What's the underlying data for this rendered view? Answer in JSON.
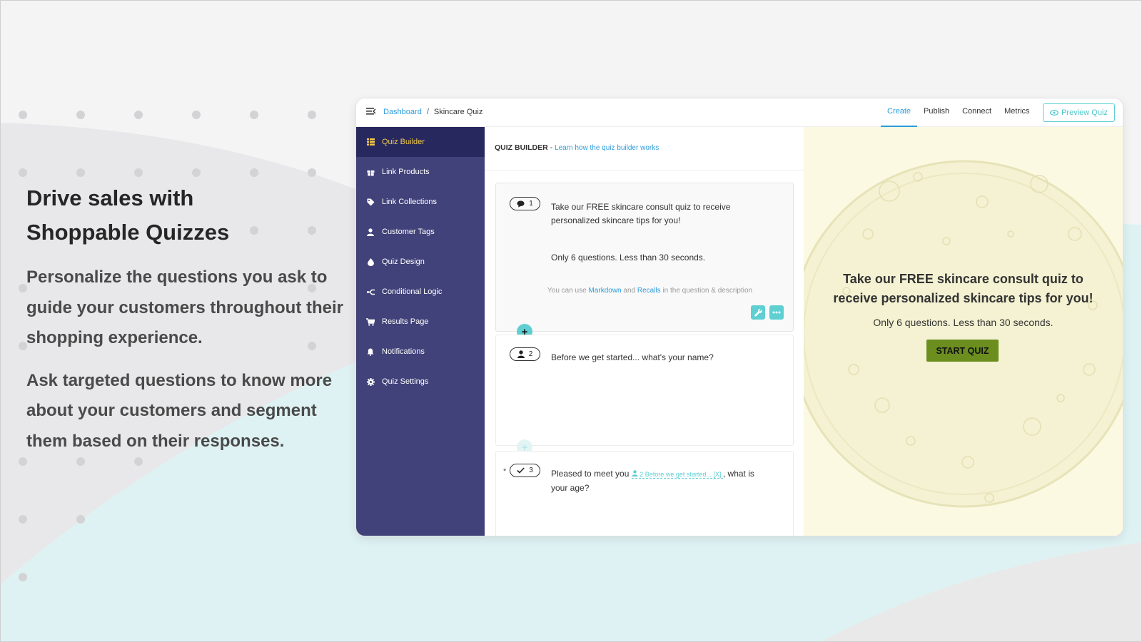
{
  "marketing": {
    "headline_line1": "Drive sales with",
    "headline_line2": "Shoppable Quizzes",
    "paragraph1": "Personalize the questions you ask to guide your customers throughout their shopping experience.",
    "paragraph2": "Ask targeted questions to know more about your customers and segment them based on their responses."
  },
  "topbar": {
    "menu_icon": "hamburger-menu-icon",
    "breadcrumb": {
      "root": "Dashboard",
      "separator": "/",
      "current": "Skincare Quiz"
    },
    "tabs": [
      {
        "label": "Create",
        "active": true
      },
      {
        "label": "Publish",
        "active": false
      },
      {
        "label": "Connect",
        "active": false
      },
      {
        "label": "Metrics",
        "active": false
      }
    ],
    "preview_button": {
      "label": "Preview Quiz",
      "icon": "eye-icon"
    }
  },
  "sidebar": {
    "items": [
      {
        "label": "Quiz Builder",
        "icon": "grid-list-icon",
        "active": true
      },
      {
        "label": "Link Products",
        "icon": "gift-icon",
        "active": false
      },
      {
        "label": "Link Collections",
        "icon": "tag-icon",
        "active": false
      },
      {
        "label": "Customer Tags",
        "icon": "user-icon",
        "active": false
      },
      {
        "label": "Quiz Design",
        "icon": "droplet-icon",
        "active": false
      },
      {
        "label": "Conditional Logic",
        "icon": "branch-icon",
        "active": false
      },
      {
        "label": "Results Page",
        "icon": "cart-icon",
        "active": false
      },
      {
        "label": "Notifications",
        "icon": "bell-icon",
        "active": false
      },
      {
        "label": "Quiz Settings",
        "icon": "gear-icon",
        "active": false
      }
    ]
  },
  "builder": {
    "heading": "QUIZ BUILDER",
    "heading_sep": "-",
    "learn_link": "Learn how the quiz builder works",
    "questions": [
      {
        "number": "1",
        "icon": "chat-bubble-icon",
        "text": "Take our FREE skincare consult quiz to receive personalized skincare tips for you!",
        "description": "Only 6 questions. Less than 30 seconds.",
        "note_prefix": "You can use",
        "note_markdown": "Markdown",
        "note_and": "and",
        "note_recalls": "Recalls",
        "note_suffix": "in the question & description"
      },
      {
        "number": "2",
        "icon": "person-icon",
        "text": "Before we get started... what's your name?"
      },
      {
        "number": "3",
        "icon": "check-icon",
        "required_mark": "*",
        "text_before": "Pleased to meet you",
        "recall_number": "2",
        "recall_text": "Before we get started... [X]",
        "text_after": ", what is",
        "text_line2": "your age?"
      }
    ]
  },
  "preview": {
    "title": "Take our FREE skincare consult quiz to receive personalized skincare tips for you!",
    "subtitle": "Only 6 questions. Less than 30 seconds.",
    "start_button": "START QUIZ"
  },
  "colors": {
    "sidebar_bg": "#414279",
    "sidebar_active_bg": "#27295e",
    "sidebar_active_text": "#f2c94c",
    "link_blue": "#2d9cdb",
    "accent_teal": "#5fcfd2",
    "preview_bg": "#fbf9e2",
    "start_button_bg": "#6b8e1e"
  }
}
